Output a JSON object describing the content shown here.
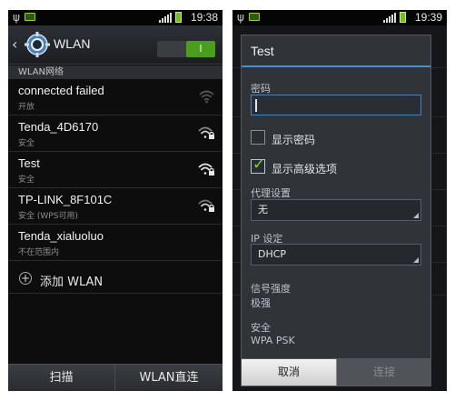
{
  "status_bar": {
    "left_time": "19:38",
    "right_time": "19:39"
  },
  "left_screen": {
    "title": "WLAN",
    "toggle_label": "I",
    "section_header": "WLAN网络",
    "networks": [
      {
        "ssid": "connected failed",
        "sub": "开放",
        "icon": "wifi-open-icon"
      },
      {
        "ssid": "Tenda_4D6170",
        "sub": "安全",
        "icon": "wifi-locked-icon"
      },
      {
        "ssid": "Test",
        "sub": "安全",
        "icon": "wifi-locked-icon"
      },
      {
        "ssid": "TP-LINK_8F101C",
        "sub": "安全 (WPS可用)",
        "icon": "wifi-locked-icon"
      },
      {
        "ssid": "Tenda_xialuoluo",
        "sub": "不在范围内",
        "icon": ""
      }
    ],
    "add_wlan_label": "添加 WLAN",
    "bottom_buttons": {
      "scan": "扫描",
      "wlan_direct": "WLAN直连"
    }
  },
  "dialog": {
    "title": "Test",
    "password_label": "密码",
    "password_value": "",
    "show_password_label": "显示密码",
    "show_password_checked": false,
    "show_advanced_label": "显示高级选项",
    "show_advanced_checked": true,
    "proxy_label": "代理设置",
    "proxy_value": "无",
    "ip_label": "IP 设定",
    "ip_value": "DHCP",
    "signal_label": "信号强度",
    "signal_value": "极强",
    "security_label": "安全",
    "security_value": "WPA PSK",
    "cancel_label": "取消",
    "connect_label": "连接"
  },
  "colors": {
    "accent_blue": "#4f8ec3",
    "toggle_green": "#4a9e1c",
    "check_green": "#7cd13a"
  }
}
